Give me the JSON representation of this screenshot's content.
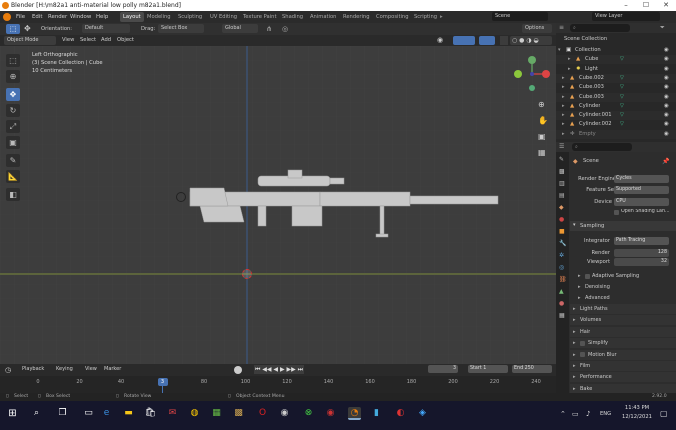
{
  "window": {
    "title": "Blender [H:\\m82a1 anti-material low polly m82a1.blend]",
    "controls": [
      "–",
      "☐",
      "✕"
    ]
  },
  "menu": {
    "items": [
      "File",
      "Edit",
      "Render",
      "Window",
      "Help"
    ],
    "workspaces": [
      "Layout",
      "Modeling",
      "Sculpting",
      "UV Editing",
      "Texture Paint",
      "Shading",
      "Animation",
      "Rendering",
      "Compositing",
      "Scripting"
    ],
    "scene_label": "Scene",
    "view_layer_label": "View Layer"
  },
  "header": {
    "orientation_label": "Orientation:",
    "orientation_value": "Default",
    "drag_label": "Drag:",
    "drag_value": "Select Box",
    "pivot": "Global",
    "options": "Options"
  },
  "view_header": {
    "mode": "Object Mode",
    "menus": [
      "View",
      "Select",
      "Add",
      "Object"
    ]
  },
  "viewport": {
    "view_name": "Left Orthographic",
    "collection_info": "(3) Scene Collection | Cube",
    "scale": "10 Centimeters"
  },
  "outliner": {
    "title": "Scene Collection",
    "rows": [
      {
        "name": "Collection",
        "icon": "collection-icon"
      },
      {
        "name": "Cube",
        "icon": "mesh-icon"
      },
      {
        "name": "Light",
        "icon": "light-icon"
      },
      {
        "name": "Cube.002",
        "icon": "mesh-icon"
      },
      {
        "name": "Cube.003",
        "icon": "mesh-icon"
      },
      {
        "name": "Cube.003",
        "icon": "mesh-icon"
      },
      {
        "name": "Cylinder",
        "icon": "mesh-icon"
      },
      {
        "name": "Cylinder.001",
        "icon": "mesh-icon"
      },
      {
        "name": "Cylinder.002",
        "icon": "mesh-icon"
      },
      {
        "name": "Empty",
        "icon": "empty-icon"
      }
    ]
  },
  "properties": {
    "context": "Scene",
    "render_engine_label": "Render Engine",
    "render_engine": "Cycles",
    "feature_set_label": "Feature Set",
    "feature_set": "Supported",
    "device_label": "Device",
    "device": "CPU",
    "osl_label": "Open Shading Lan...",
    "sampling": "Sampling",
    "integrator_label": "Integrator",
    "integrator": "Path Tracing",
    "render_label": "Render",
    "render_value": "128",
    "viewport_label": "Viewport",
    "viewport_value": "32",
    "sub_panels": [
      "Adaptive Sampling",
      "Denoising",
      "Advanced"
    ],
    "panels": [
      "Light Paths",
      "Volumes",
      "Hair",
      "Simplify",
      "Motion Blur",
      "Film",
      "Performance",
      "Bake"
    ]
  },
  "timeline": {
    "menus": [
      "Playback",
      "Keying",
      "View",
      "Marker"
    ],
    "current_frame": "3",
    "start_label": "Start",
    "start": "1",
    "end_label": "End",
    "end": "250",
    "ticks": [
      "0",
      "20",
      "40",
      "60",
      "80",
      "100",
      "120",
      "140",
      "160",
      "180",
      "200",
      "220",
      "240"
    ],
    "frame_indicator": "3",
    "frame_indicator_fraction": 0.0125
  },
  "status": {
    "select": "Select",
    "box_select": "Box Select",
    "rotate_view": "Rotate View",
    "context_menu": "Object Context Menu",
    "version": "2.92.0"
  },
  "taskbar": {
    "time": "11:43 PM",
    "date": "12/12/2021",
    "lang": "ENG"
  }
}
